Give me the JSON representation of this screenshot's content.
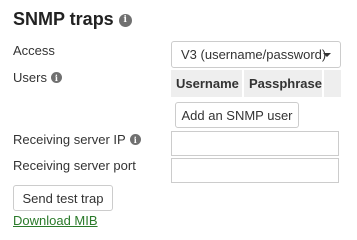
{
  "section": {
    "title": "SNMP traps"
  },
  "access": {
    "label": "Access",
    "selected": "V3 (username/password)"
  },
  "users": {
    "label": "Users",
    "columns": [
      "Username",
      "Passphrase"
    ],
    "add_button": "Add an SNMP user"
  },
  "receiving_server_ip": {
    "label": "Receiving server IP",
    "value": ""
  },
  "receiving_server_port": {
    "label": "Receiving server port",
    "value": ""
  },
  "actions": {
    "send_test_trap": "Send test trap",
    "download_mib": "Download MIB"
  },
  "icons": {
    "info": "info-icon",
    "dropdown": "chevron-down-icon"
  },
  "colors": {
    "link": "#2a7a2a",
    "table_header_bg": "#eeeeee"
  }
}
